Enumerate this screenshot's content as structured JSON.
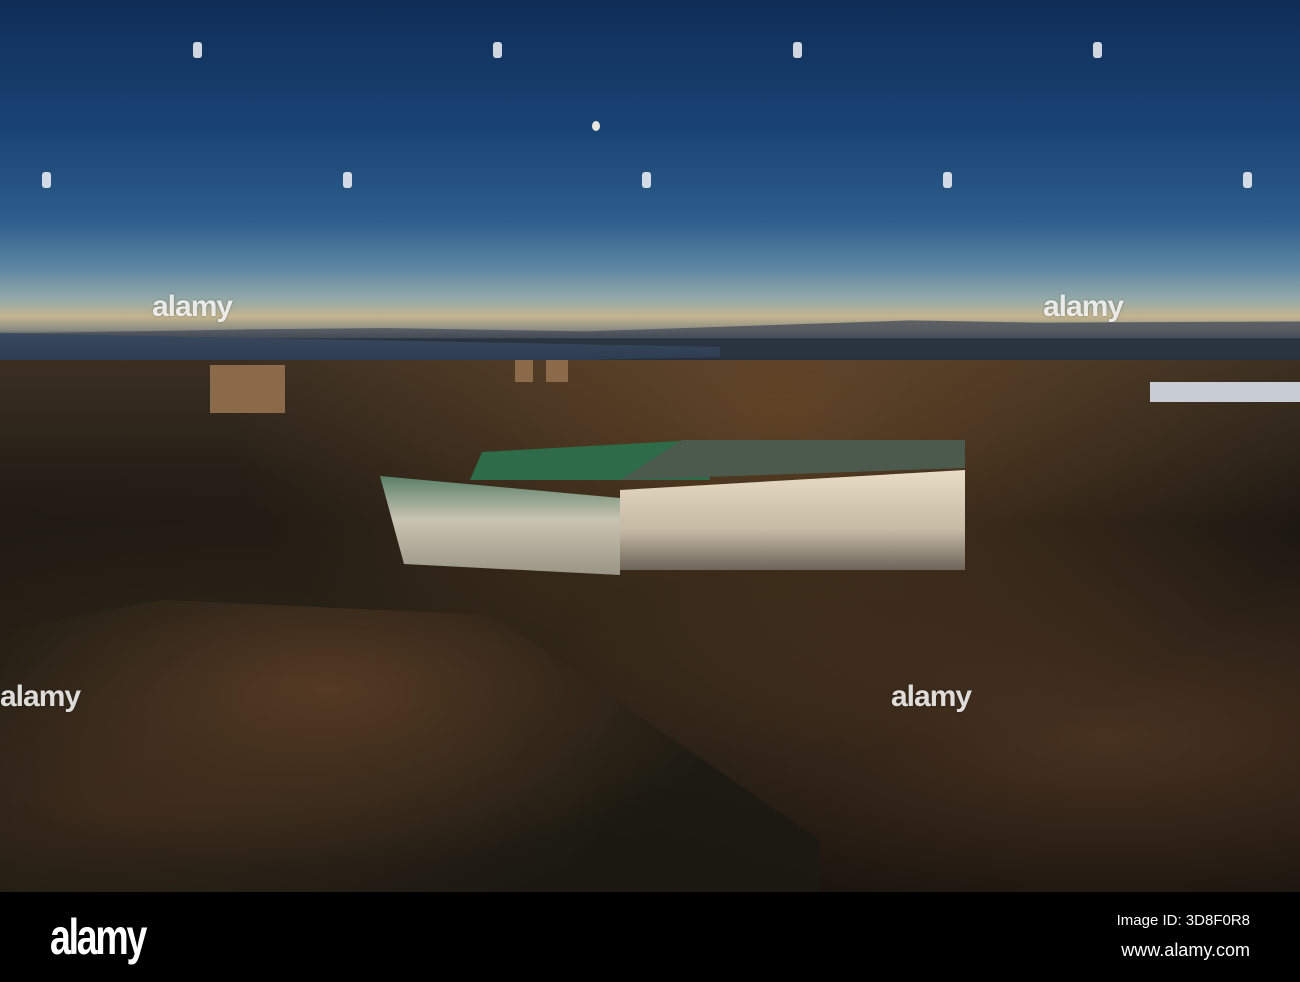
{
  "watermark": {
    "brand": "alamy"
  },
  "footer": {
    "logo": "alamy",
    "image_id": "Image ID: 3D8F0R8",
    "url": "www.alamy.com"
  }
}
